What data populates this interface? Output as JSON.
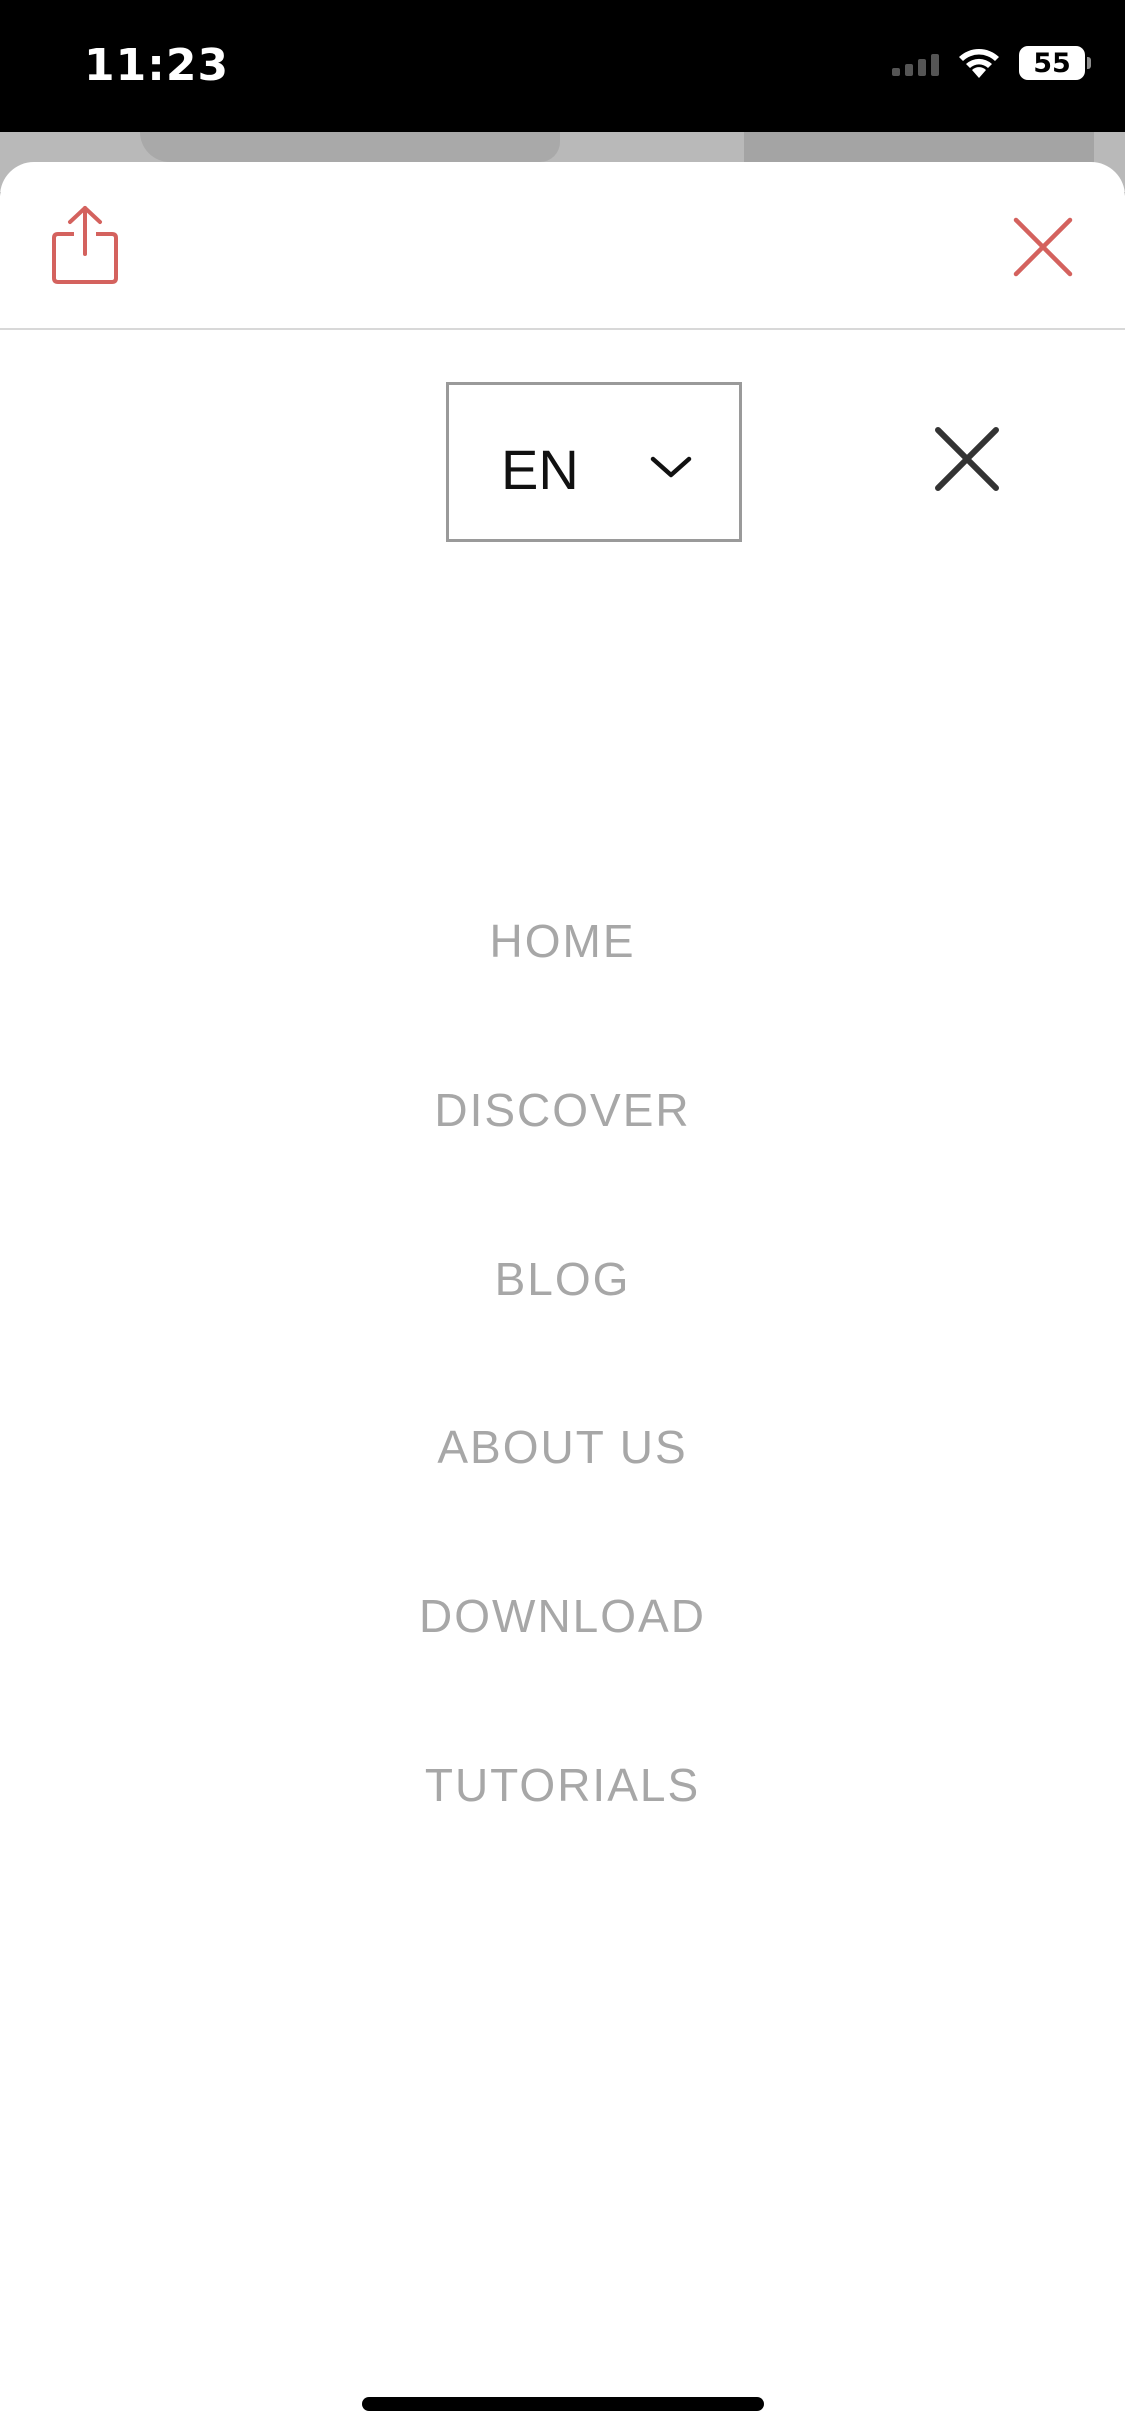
{
  "status_bar": {
    "time": "11:23",
    "battery": "55"
  },
  "sheet_header": {
    "share_icon": "share-icon",
    "close_icon": "close-icon",
    "accent_color": "#d4625e"
  },
  "language": {
    "selected": "EN"
  },
  "menu": {
    "close_icon": "close-icon",
    "items": [
      {
        "label": "HOME"
      },
      {
        "label": "DISCOVER"
      },
      {
        "label": "BLOG"
      },
      {
        "label": "ABOUT US"
      },
      {
        "label": "DOWNLOAD"
      },
      {
        "label": "TUTORIALS"
      }
    ]
  }
}
